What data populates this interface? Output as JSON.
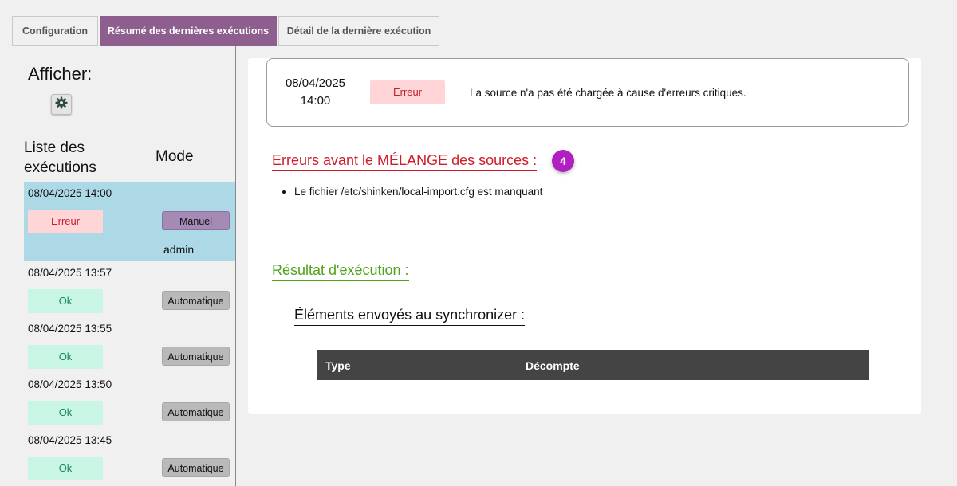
{
  "tabs": [
    {
      "label": "Configuration"
    },
    {
      "label": "Résumé des dernières exécutions"
    },
    {
      "label": "Détail de la dernière exécution"
    }
  ],
  "sidebar": {
    "show_label": "Afficher:",
    "settings_icon": "gear-icon",
    "col_list": "Liste des exécutions",
    "col_mode": "Mode",
    "runs": [
      {
        "date": "08/04/2025 14:00",
        "status": "Erreur",
        "mode": "Manuel",
        "user": "admin"
      },
      {
        "date": "08/04/2025 13:57",
        "status": "Ok",
        "mode": "Automatique"
      },
      {
        "date": "08/04/2025 13:55",
        "status": "Ok",
        "mode": "Automatique"
      },
      {
        "date": "08/04/2025 13:50",
        "status": "Ok",
        "mode": "Automatique"
      },
      {
        "date": "08/04/2025 13:45",
        "status": "Ok",
        "mode": "Automatique"
      }
    ]
  },
  "summary": {
    "date": "08/04/2025",
    "time": "14:00",
    "status": "Erreur",
    "message": "La source n'a pas été chargée à cause d'erreurs critiques."
  },
  "errors": {
    "title": "Erreurs avant le MÉLANGE des sources :",
    "count": "4",
    "items": [
      "Le fichier /etc/shinken/local-import.cfg est manquant"
    ]
  },
  "result": {
    "title": "Résultat d'exécution :",
    "sync_title": "Éléments envoyés au synchronizer :",
    "columns": [
      "Type",
      "Décompte"
    ]
  },
  "colors": {
    "active_tab": "#8e5e8e",
    "error_text": "#d01c2a",
    "success_text": "#4fa21a",
    "selected_row": "#add8e6",
    "count_badge": "#b01fbf"
  }
}
